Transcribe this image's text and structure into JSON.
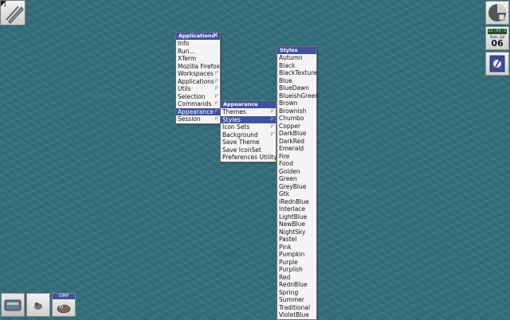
{
  "workspace_corner": {
    "number": "1"
  },
  "clock": {
    "time": "15:49:21",
    "day": "Sun, Jul",
    "date": "06"
  },
  "dock_bottom": {
    "gimp_label": "GIMP"
  },
  "applications_menu": {
    "title": "Applications",
    "items": [
      {
        "label": "Info",
        "submenu": false
      },
      {
        "label": "Run...",
        "submenu": false
      },
      {
        "label": "XTerm",
        "submenu": false
      },
      {
        "label": "Mozilla Firefox",
        "submenu": false
      },
      {
        "label": "Workspaces",
        "submenu": true
      },
      {
        "label": "Applications",
        "submenu": true
      },
      {
        "label": "Utils",
        "submenu": true
      },
      {
        "label": "Selection",
        "submenu": true
      },
      {
        "label": "Commands",
        "submenu": true
      },
      {
        "label": "Appearance",
        "submenu": true,
        "selected": true
      },
      {
        "label": "Session",
        "submenu": true
      }
    ]
  },
  "appearance_menu": {
    "title": "Appearance",
    "items": [
      {
        "label": "Themes",
        "submenu": true
      },
      {
        "label": "Styles",
        "submenu": true,
        "selected": true
      },
      {
        "label": "Icon Sets",
        "submenu": true
      },
      {
        "label": "Background",
        "submenu": true
      },
      {
        "label": "Save Theme",
        "submenu": false
      },
      {
        "label": "Save IconSet",
        "submenu": false
      },
      {
        "label": "Preferences Utility",
        "submenu": false
      }
    ]
  },
  "styles_menu": {
    "title": "Styles",
    "items": [
      "Autumn",
      "Black",
      "BlackTexture",
      "Blue",
      "BlueDawn",
      "BlueishGreen",
      "Brown",
      "Brownish",
      "Chumbo",
      "Copper",
      "DarkBlue",
      "DarkRed",
      "Emerald",
      "Fire",
      "Food",
      "Golden",
      "Green",
      "GreyBlue",
      "Gtk",
      "IRednBlue",
      "Interlace",
      "LightBlue",
      "NewBlue",
      "NightSky",
      "Pastel",
      "Pink",
      "Pumpkin",
      "Purple",
      "Purplish",
      "Red",
      "RednBlue",
      "Spring",
      "Summer",
      "Traditional",
      "VioletBlue"
    ]
  },
  "colors": {
    "menu_title_bg": "#3f52a0",
    "desktop": "#336e7c"
  }
}
